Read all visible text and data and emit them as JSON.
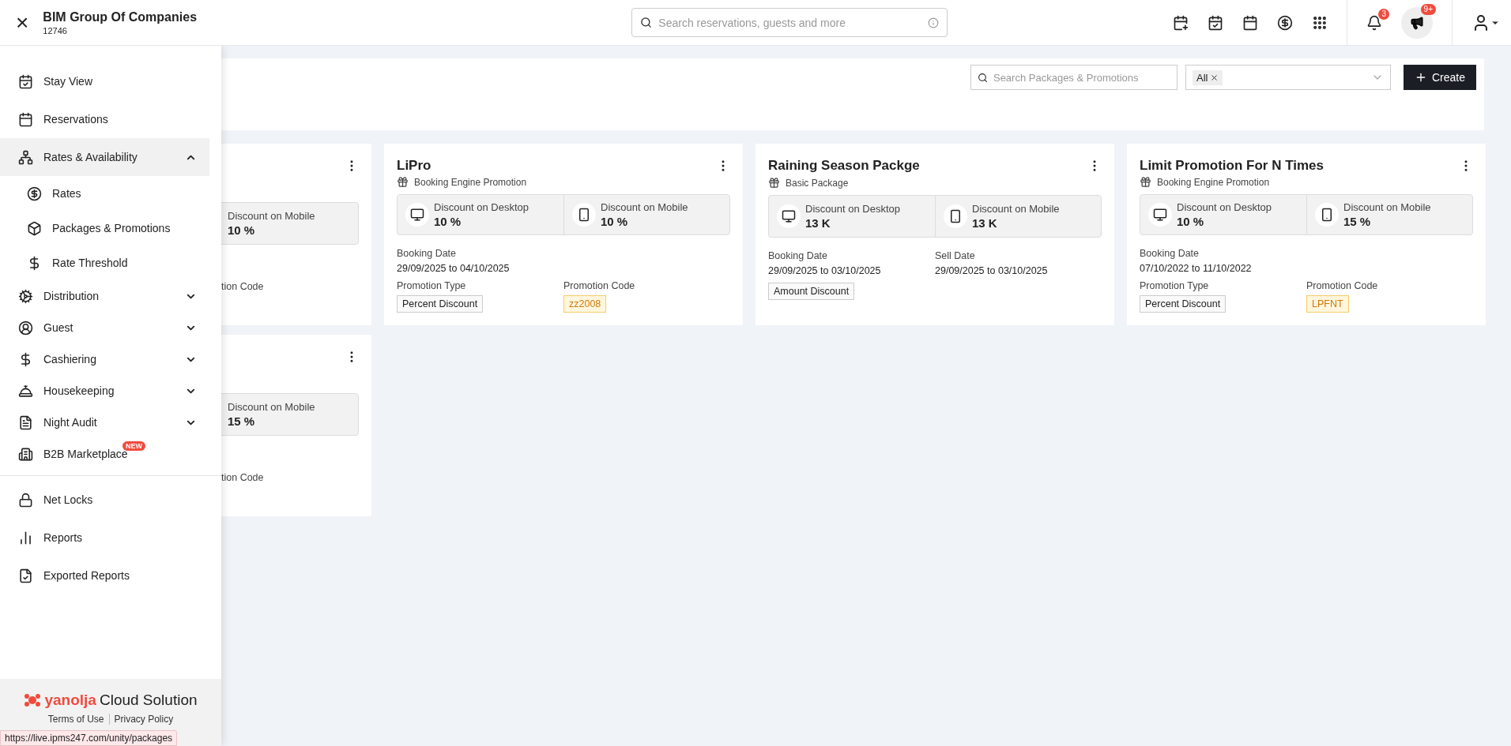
{
  "topbar": {
    "close": "×",
    "company": "BIM Group Of Companies",
    "code": "12746",
    "search": {
      "placeholder": "Search reservations, guests and more"
    },
    "notifications": "3",
    "announcements": "9+"
  },
  "sidebar": {
    "items": [
      {
        "label": "Stay View"
      },
      {
        "label": "Reservations"
      },
      {
        "label": "Rates & Availability",
        "expanded": true,
        "children": [
          {
            "label": "Rates"
          },
          {
            "label": "Packages & Promotions"
          },
          {
            "label": "Rate Threshold"
          }
        ]
      },
      {
        "label": "Distribution",
        "expanded": false
      },
      {
        "label": "Guest",
        "expanded": false
      },
      {
        "label": "Cashiering",
        "expanded": false
      },
      {
        "label": "Housekeeping",
        "expanded": false
      },
      {
        "label": "Night Audit",
        "expanded": false
      },
      {
        "label": "B2B Marketplace",
        "badge": "NEW"
      }
    ],
    "bottom_items": [
      {
        "label": "Net Locks"
      },
      {
        "label": "Reports"
      },
      {
        "label": "Exported Reports"
      }
    ],
    "logo": {
      "brand": "yanolja",
      "tagline": "Cloud Solution"
    },
    "links": [
      "Terms of Use",
      "Privacy Policy"
    ]
  },
  "toolbar": {
    "search": {
      "placeholder": "Search Packages & Promotions"
    },
    "filter_tag": "All",
    "create": "Create"
  },
  "cards": [
    {
      "kind": "partial",
      "mobile": {
        "label": "Discount on Mobile",
        "value": "10 %"
      },
      "code_label": "tion Code"
    },
    {
      "kind": "full",
      "title": "LiPro",
      "type": "Booking Engine Promotion",
      "desktop": {
        "label": "Discount on Desktop",
        "value": "10 %"
      },
      "mobile": {
        "label": "Discount on Mobile",
        "value": "10 %"
      },
      "rows": [
        [
          {
            "label": "Booking Date",
            "value": "29/09/2025 to 04/10/2025",
            "kind": "text"
          }
        ],
        [
          {
            "label": "Promotion Type",
            "value": "Percent Discount",
            "kind": "tag"
          },
          {
            "label": "Promotion Code",
            "value": "zz2008",
            "kind": "code"
          }
        ]
      ]
    },
    {
      "kind": "full",
      "title": "Raining Season Packge",
      "type": "Basic Package",
      "desktop": {
        "label": "Discount on Desktop",
        "value": "13 K"
      },
      "mobile": {
        "label": "Discount on Mobile",
        "value": "13 K"
      },
      "rows": [
        [
          {
            "label": "Booking Date",
            "value": "29/09/2025 to 03/10/2025",
            "kind": "text"
          },
          {
            "label": "Sell Date",
            "value": "29/09/2025 to 03/10/2025",
            "kind": "text"
          }
        ],
        [
          {
            "value": "Amount Discount",
            "kind": "tag"
          }
        ]
      ]
    },
    {
      "kind": "full",
      "title": "Limit Promotion For N Times",
      "type": "Booking Engine Promotion",
      "desktop": {
        "label": "Discount on Desktop",
        "value": "10 %"
      },
      "mobile": {
        "label": "Discount on Mobile",
        "value": "15 %"
      },
      "rows": [
        [
          {
            "label": "Booking Date",
            "value": "07/10/2022 to 11/10/2022",
            "kind": "text"
          }
        ],
        [
          {
            "label": "Promotion Type",
            "value": "Percent Discount",
            "kind": "tag"
          },
          {
            "label": "Promotion Code",
            "value": "LPFNT",
            "kind": "code"
          }
        ]
      ]
    },
    {
      "kind": "partial",
      "mobile": {
        "label": "Discount on Mobile",
        "value": "15 %"
      },
      "code_label": "tion Code"
    }
  ],
  "status_url": "https://live.ipms247.com/unity/packages"
}
